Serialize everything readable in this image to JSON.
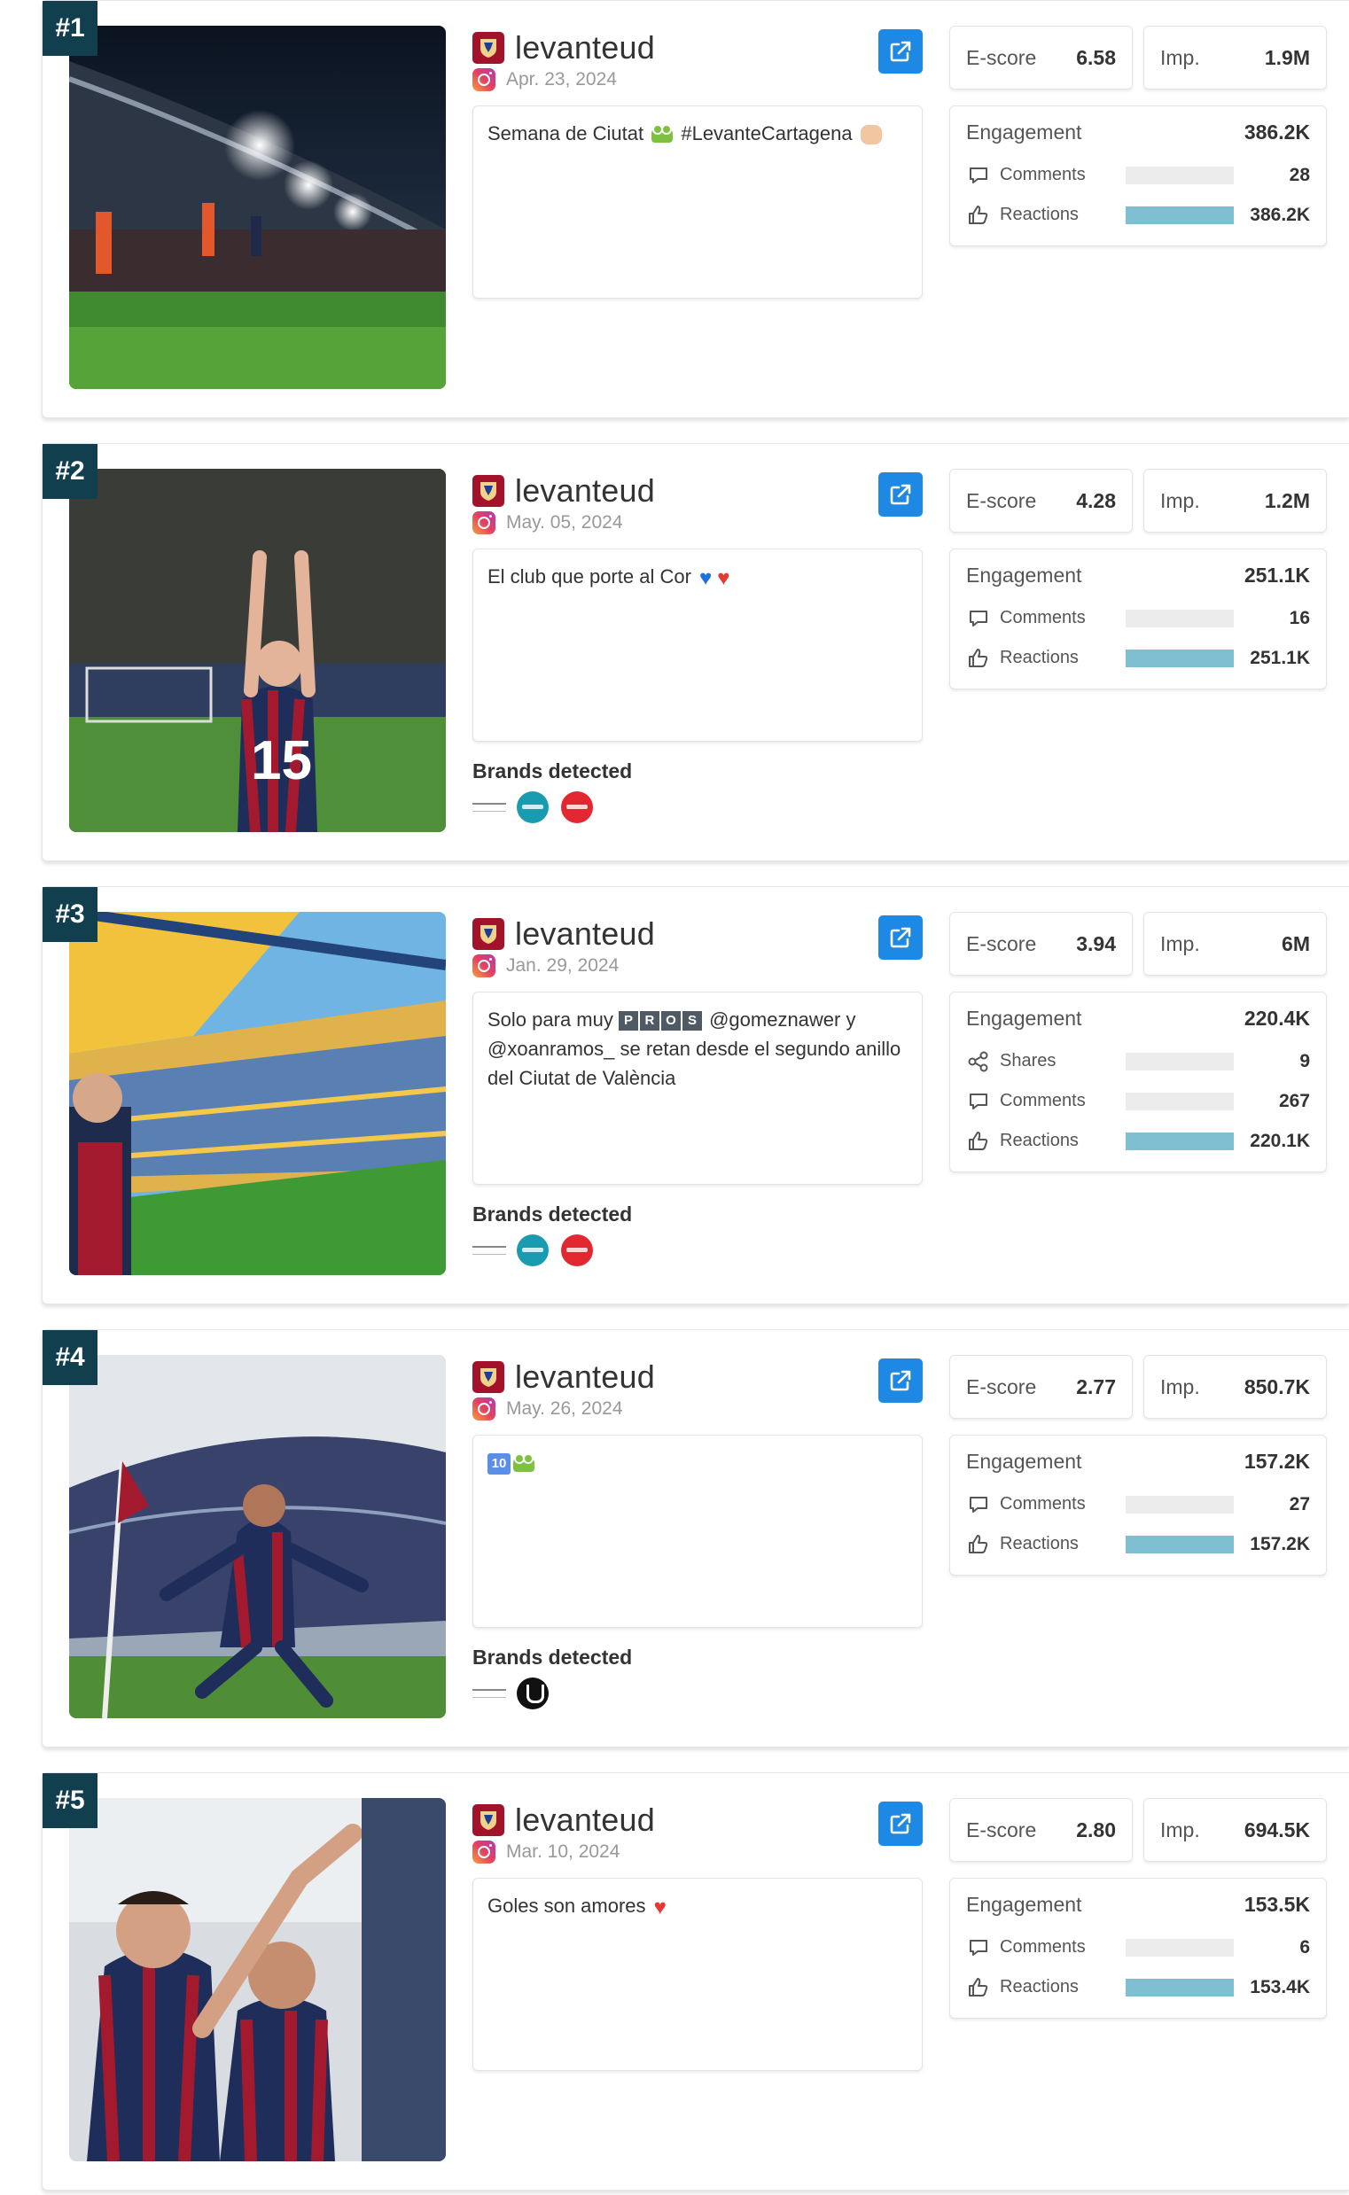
{
  "posts": [
    {
      "rank": "#1",
      "handle": "levanteud",
      "date": "Apr. 23, 2024",
      "caption": [
        "Semana de Ciutat ",
        "[frog]",
        " #LevanteCartagena ",
        "[fist]"
      ],
      "escore_label": "E-score",
      "escore": "6.58",
      "imp_label": "Imp.",
      "imp": "1.9M",
      "engagement_label": "Engagement",
      "engagement": "386.2K",
      "metrics": [
        {
          "icon": "comment-icon",
          "label": "Comments",
          "value": "28",
          "fill": 0.0
        },
        {
          "icon": "thumbs-up-icon",
          "label": "Reactions",
          "value": "386.2K",
          "fill": 1.0
        }
      ],
      "brands_title": "",
      "brands": [],
      "photo": "stadium-night"
    },
    {
      "rank": "#2",
      "handle": "levanteud",
      "date": "May. 05, 2024",
      "caption": [
        "El club que porte al Cor ",
        "[blueheart]",
        "[heart]"
      ],
      "escore_label": "E-score",
      "escore": "4.28",
      "imp_label": "Imp.",
      "imp": "1.2M",
      "engagement_label": "Engagement",
      "engagement": "251.1K",
      "metrics": [
        {
          "icon": "comment-icon",
          "label": "Comments",
          "value": "16",
          "fill": 0.0
        },
        {
          "icon": "thumbs-up-icon",
          "label": "Reactions",
          "value": "251.1K",
          "fill": 1.0
        }
      ],
      "brands_title": "Brands detected",
      "brands": [
        "text",
        "teal",
        "red"
      ],
      "photo": "player-clapping"
    },
    {
      "rank": "#3",
      "handle": "levanteud",
      "date": "Jan. 29, 2024",
      "caption": [
        "Solo para muy ",
        "[PROS]",
        " @gomeznawer y @xoanramos_ se retan desde el segundo anillo del Ciutat de València"
      ],
      "escore_label": "E-score",
      "escore": "3.94",
      "imp_label": "Imp.",
      "imp": "6M",
      "engagement_label": "Engagement",
      "engagement": "220.4K",
      "metrics": [
        {
          "icon": "share-icon",
          "label": "Shares",
          "value": "9",
          "fill": 0.0
        },
        {
          "icon": "comment-icon",
          "label": "Comments",
          "value": "267",
          "fill": 0.0
        },
        {
          "icon": "thumbs-up-icon",
          "label": "Reactions",
          "value": "220.1K",
          "fill": 1.0
        }
      ],
      "brands_title": "Brands detected",
      "brands": [
        "text",
        "teal",
        "red"
      ],
      "photo": "stadium-day"
    },
    {
      "rank": "#4",
      "handle": "levanteud",
      "date": "May. 26, 2024",
      "caption": [
        "[ten]",
        "[frog]"
      ],
      "escore_label": "E-score",
      "escore": "2.77",
      "imp_label": "Imp.",
      "imp": "850.7K",
      "engagement_label": "Engagement",
      "engagement": "157.2K",
      "metrics": [
        {
          "icon": "comment-icon",
          "label": "Comments",
          "value": "27",
          "fill": 0.0
        },
        {
          "icon": "thumbs-up-icon",
          "label": "Reactions",
          "value": "157.2K",
          "fill": 1.0
        }
      ],
      "brands_title": "Brands detected",
      "brands": [
        "text",
        "black"
      ],
      "photo": "player-celebrating"
    },
    {
      "rank": "#5",
      "handle": "levanteud",
      "date": "Mar. 10, 2024",
      "caption": [
        "Goles son amores ",
        "[heart]"
      ],
      "escore_label": "E-score",
      "escore": "2.80",
      "imp_label": "Imp.",
      "imp": "694.5K",
      "engagement_label": "Engagement",
      "engagement": "153.5K",
      "metrics": [
        {
          "icon": "comment-icon",
          "label": "Comments",
          "value": "6",
          "fill": 0.0
        },
        {
          "icon": "thumbs-up-icon",
          "label": "Reactions",
          "value": "153.4K",
          "fill": 1.0
        }
      ],
      "brands_title": "",
      "brands": [],
      "photo": "players-hugging"
    }
  ],
  "colors": {
    "rank_badge": "#123f4d",
    "open_button": "#1e88e5",
    "bar_fill": "#7fbfd1",
    "bar_track": "#ececec",
    "club": "#a3122b"
  }
}
